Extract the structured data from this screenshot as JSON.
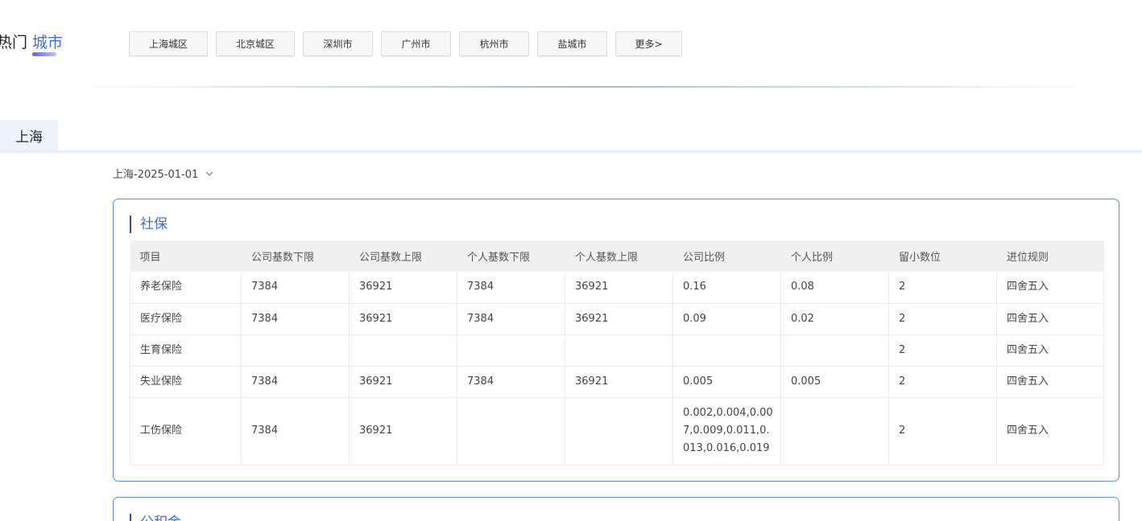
{
  "hot_cities": {
    "title_prefix": "热门",
    "title_accent": "城市",
    "chips": [
      "上海城区",
      "北京城区",
      "深圳市",
      "广州市",
      "杭州市",
      "盐城市",
      "更多>"
    ]
  },
  "region_tab": "上海",
  "version_select": {
    "value": "上海-2025-01-01",
    "icon": "chevron-down-icon"
  },
  "social_insurance": {
    "title": "社保",
    "columns": [
      "项目",
      "公司基数下限",
      "公司基数上限",
      "个人基数下限",
      "个人基数上限",
      "公司比例",
      "个人比例",
      "留小数位",
      "进位规则"
    ],
    "rows": [
      [
        "养老保险",
        "7384",
        "36921",
        "7384",
        "36921",
        "0.16",
        "0.08",
        "2",
        "四舍五入"
      ],
      [
        "医疗保险",
        "7384",
        "36921",
        "7384",
        "36921",
        "0.09",
        "0.02",
        "2",
        "四舍五入"
      ],
      [
        "生育保险",
        "",
        "",
        "",
        "",
        "",
        "",
        "2",
        "四舍五入"
      ],
      [
        "失业保险",
        "7384",
        "36921",
        "7384",
        "36921",
        "0.005",
        "0.005",
        "2",
        "四舍五入"
      ],
      [
        "工伤保险",
        "7384",
        "36921",
        "",
        "",
        "0.002,0.004,0.007,0.009,0.011,0.013,0.016,0.019",
        "",
        "2",
        "四舍五入"
      ]
    ]
  },
  "housing_fund": {
    "title": "公积金"
  },
  "colors": {
    "accent": "#3d6fd8",
    "card_border": "#5b8fe6",
    "header_bg": "#f0f0f0",
    "tab_bg": "#eef3fb"
  }
}
